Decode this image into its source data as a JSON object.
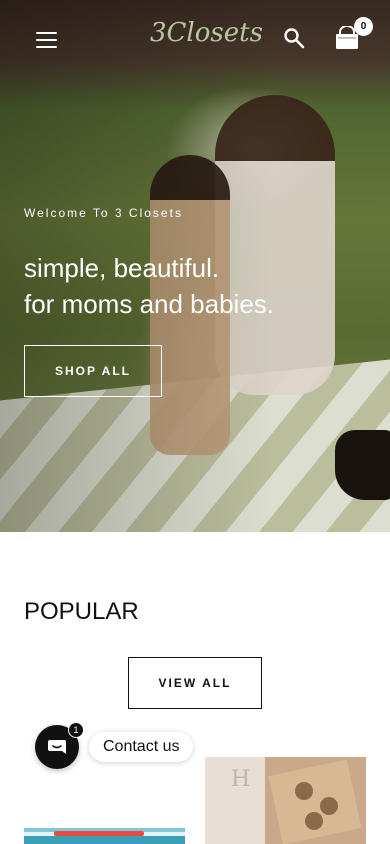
{
  "header": {
    "logo_text": "3Closets",
    "cart_count": "0"
  },
  "hero": {
    "welcome": "Welcome To 3 Closets",
    "headline_line1": "simple, beautiful.",
    "headline_line2": "for moms and babies.",
    "cta_label": "SHOP ALL"
  },
  "popular": {
    "title": "POPULAR",
    "view_all_label": "VIEW ALL"
  },
  "contact": {
    "label": "Contact us",
    "badge_count": "1"
  },
  "product_images": [
    {
      "letter": ""
    },
    {
      "letter": "H"
    }
  ],
  "icons": [
    "menu-icon",
    "search-icon",
    "cart-icon",
    "chat-icon"
  ],
  "colors": {
    "logo": "#b9c6a1",
    "button_border_dark": "#111111",
    "chat_button": "#111111"
  }
}
